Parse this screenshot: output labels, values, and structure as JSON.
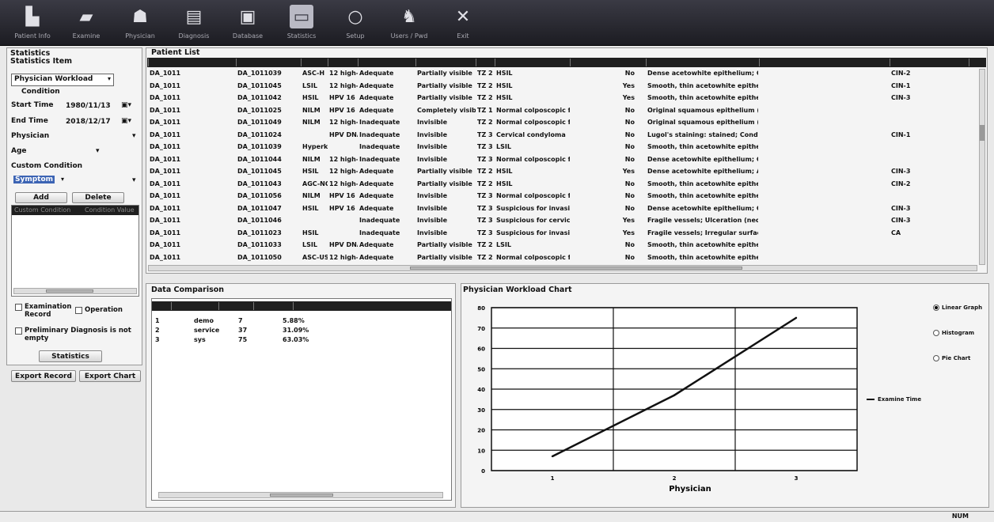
{
  "toolbar": {
    "items": [
      {
        "label": "Patient Info",
        "icon": "patient-info-icon"
      },
      {
        "label": "Examine",
        "icon": "examine-icon"
      },
      {
        "label": "Physician",
        "icon": "physician-icon"
      },
      {
        "label": "Diagnosis",
        "icon": "diagnosis-icon"
      },
      {
        "label": "Database",
        "icon": "database-icon"
      },
      {
        "label": "Statistics",
        "icon": "statistics-icon",
        "active": true
      },
      {
        "label": "Setup",
        "icon": "setup-icon"
      },
      {
        "label": "Users / Pwd",
        "icon": "users-icon"
      },
      {
        "label": "Exit",
        "icon": "exit-icon"
      }
    ]
  },
  "left": {
    "title": "Statistics",
    "item_label": "Statistics Item",
    "item_value": "Physician Workload",
    "condition_label": "Condition",
    "start_label": "Start Time",
    "start_value": "1980/11/13",
    "end_label": "End Time",
    "end_value": "2018/12/17",
    "physician_label": "Physician",
    "age_label": "Age",
    "custom_label": "Custom Condition",
    "custom_value": "Symptom",
    "add_label": "Add",
    "delete_label": "Delete",
    "list_headers": [
      "Custom Condition",
      "Condition Value"
    ],
    "chk_exam": "Examination Record",
    "chk_operation": "Operation",
    "chk_prelim": "Preliminary Diagnosis is not empty",
    "statistics_btn": "Statistics",
    "export_record": "Export Record",
    "export_chart": "Export Chart"
  },
  "patient_list": {
    "title": "Patient List",
    "rows": [
      [
        "DA_1011",
        "DA_1011039",
        "ASC-H",
        "12 high-risk",
        "Adequate",
        "Partially visible",
        "TZ 2",
        "HSIL",
        "No",
        "Dense acetowhite epithelium; Co",
        "CIN-2"
      ],
      [
        "DA_1011",
        "DA_1011045",
        "LSIL",
        "12 high-risk",
        "Adequate",
        "Partially visible",
        "TZ 2",
        "HSIL",
        "Yes",
        "Smooth, thin acetowhite epitheliu",
        "CIN-1"
      ],
      [
        "DA_1011",
        "DA_1011042",
        "HSIL",
        "HPV 16",
        "Adequate",
        "Partially visible",
        "TZ 2",
        "HSIL",
        "Yes",
        "Smooth, thin acetowhite epitheliu",
        "CIN-3"
      ],
      [
        "DA_1011",
        "DA_1011025",
        "NILM",
        "HPV 16",
        "Adequate",
        "Completely visible",
        "TZ 1",
        "Normal colposcopic findings",
        "No",
        "Original squamous epithelium (Ma",
        ""
      ],
      [
        "DA_1011",
        "DA_1011049",
        "NILM",
        "12 high-risk",
        "Inadequate",
        "Invisible",
        "TZ 2",
        "Normal colposcopic findings",
        "No",
        "Original squamous epithelium (Ma",
        ""
      ],
      [
        "DA_1011",
        "DA_1011024",
        "",
        "HPV DNA",
        "Inadequate",
        "Invisible",
        "TZ 3",
        "Cervical condyloma",
        "No",
        "Lugol's staining: stained; Condyl",
        "CIN-1"
      ],
      [
        "DA_1011",
        "DA_1011039",
        "Hyperker",
        "",
        "Inadequate",
        "Invisible",
        "TZ 3",
        "LSIL",
        "No",
        "Smooth, thin acetowhite epitheliu",
        ""
      ],
      [
        "DA_1011",
        "DA_1011044",
        "NILM",
        "12 high-risk",
        "Inadequate",
        "Invisible",
        "TZ 3",
        "Normal colposcopic findings",
        "No",
        "Dense acetowhite epithelium; Co",
        ""
      ],
      [
        "DA_1011",
        "DA_1011045",
        "HSIL",
        "12 high-risk",
        "Adequate",
        "Partially visible",
        "TZ 2",
        "HSIL",
        "Yes",
        "Dense acetowhite epithelium; Ab",
        "CIN-3"
      ],
      [
        "DA_1011",
        "DA_1011043",
        "AGC-NOS",
        "12 high-risk",
        "Adequate",
        "Partially visible",
        "TZ 2",
        "HSIL",
        "No",
        "Smooth, thin acetowhite epitheliu",
        "CIN-2"
      ],
      [
        "DA_1011",
        "DA_1011056",
        "NILM",
        "HPV 16",
        "Adequate",
        "Invisible",
        "TZ 3",
        "Normal colposcopic findings",
        "No",
        "Smooth, thin acetowhite epitheliu",
        ""
      ],
      [
        "DA_1011",
        "DA_1011047",
        "HSIL",
        "HPV 16",
        "Adequate",
        "Invisible",
        "TZ 3",
        "Suspicious for invasion",
        "No",
        "Dense acetowhite epithelium; Co",
        "CIN-3"
      ],
      [
        "DA_1011",
        "DA_1011046",
        "",
        "",
        "Inadequate",
        "Invisible",
        "TZ 3",
        "Suspicious for cervical",
        "Yes",
        "Fragile vessels; Ulceration (necr",
        "CIN-3"
      ],
      [
        "DA_1011",
        "DA_1011023",
        "HSIL",
        "",
        "Inadequate",
        "Invisible",
        "TZ 3",
        "Suspicious for invasion",
        "Yes",
        "Fragile vessels; Irregular surface;",
        "CA"
      ],
      [
        "DA_1011",
        "DA_1011033",
        "LSIL",
        "HPV DNA",
        "Adequate",
        "Partially visible",
        "TZ 2",
        "LSIL",
        "No",
        "Smooth, thin acetowhite epitheliu",
        ""
      ],
      [
        "DA_1011",
        "DA_1011050",
        "ASC-US",
        "12 high-risk",
        "Adequate",
        "Partially visible",
        "TZ 2",
        "Normal colposcopic findings",
        "No",
        "Smooth, thin acetowhite epitheliu",
        ""
      ]
    ]
  },
  "comparison": {
    "title": "Data Comparison",
    "rows": [
      [
        "1",
        "demo",
        "7",
        "5.88%"
      ],
      [
        "2",
        "service",
        "37",
        "31.09%"
      ],
      [
        "3",
        "sys",
        "75",
        "63.03%"
      ]
    ]
  },
  "chart_panel": {
    "title": "Physician Workload Chart",
    "options": [
      "Linear Graph",
      "Histogram",
      "Pie Chart"
    ],
    "selected_option": 0
  },
  "chart_data": {
    "type": "line",
    "x": [
      "1",
      "2",
      "3"
    ],
    "series": [
      {
        "name": "Examine Time",
        "values": [
          7,
          37,
          75
        ]
      }
    ],
    "xlabel": "Physician",
    "ylabel": "",
    "ylim": [
      0,
      80
    ],
    "yticks": [
      "0",
      "10",
      "20",
      "30",
      "40",
      "50",
      "60",
      "70",
      "80"
    ],
    "grid": true,
    "legend": "right"
  },
  "status": {
    "num": "NUM"
  },
  "colors": {
    "toolbar": "#26262d",
    "header": "#1f1f1f",
    "line": "#111111"
  }
}
